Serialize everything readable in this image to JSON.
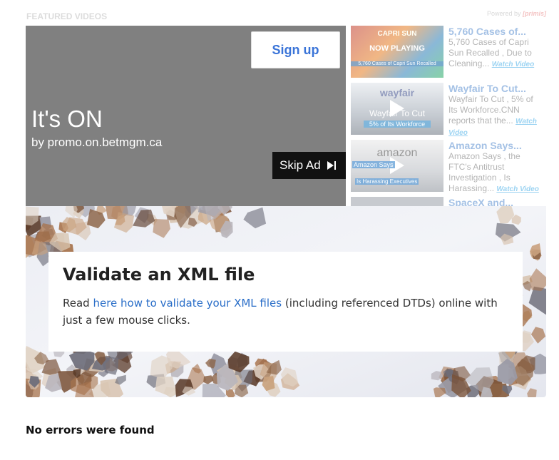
{
  "featured": {
    "label": "FEATURED VIDEOS",
    "powered_by": "Powered by",
    "powered_brand": "[primis]"
  },
  "ad": {
    "signup_label": "Sign up",
    "title": "It's ON",
    "subtitle": "by promo.on.betmgm.ca",
    "skip_label": "Skip Ad"
  },
  "playlist": [
    {
      "title": "5,760 Cases of...",
      "desc": "5,760 Cases of Capri Sun Recalled , Due to Cleaning...",
      "watch": "Watch Video",
      "thumb_top": "CAPRI SUN",
      "thumb_caption": "NOW PLAYING",
      "thumb_bottom": "5,760 Cases of Capri Sun Recalled"
    },
    {
      "title": "Wayfair To Cut...",
      "desc": "Wayfair To Cut , 5% of Its Workforce.CNN reports that the...",
      "watch": "Watch Video",
      "thumb_top": "wayfair",
      "thumb_caption": "Wayfair To Cut",
      "thumb_bottom": "5% of Its Workforce"
    },
    {
      "title": "Amazon Says...",
      "desc": "Amazon Says , the FTC's Antitrust Investigation , Is Harassing...",
      "watch": "Watch Video",
      "thumb_top": "amazon",
      "thumb_caption": "Amazon Says",
      "thumb_bottom": "Is Harassing Executives"
    },
    {
      "title": "SpaceX and...",
      "desc": "",
      "watch": "",
      "thumb_top": "",
      "thumb_caption": "",
      "thumb_bottom": ""
    }
  ],
  "card": {
    "heading": "Validate an XML file",
    "text_before": "Read ",
    "link": "here how to validate your XML files",
    "text_after": " (including referenced DTDs) online with just a few mouse clicks."
  },
  "result": "No errors were found",
  "colors": {
    "accent_link": "#2a6ec8",
    "signup_text": "#3a74d8",
    "player_bg": "#808080"
  }
}
